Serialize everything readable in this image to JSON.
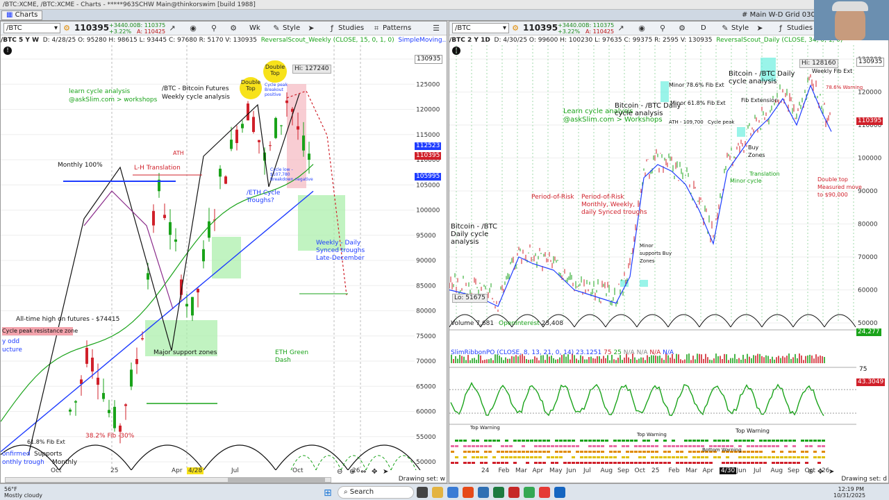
{
  "window": {
    "title": "/BTC:XCME, /BTC:XCME - Charts - *****963SCHW Main@thinkorswim [build 1988]",
    "tab_label": "Charts",
    "grid_label": "Main W-D Grid 030120"
  },
  "left": {
    "symbol": "/BTC",
    "price": "110395",
    "change": "+3440.00",
    "change_pct": "+3.22%",
    "bid": "B: 110375",
    "ask": "A: 110425",
    "timeframe": "/BTC 5 Y W",
    "info": "D: 4/28/25  O: 95280  H: 98615  L: 93445  C: 97680  R: 5170  V: 130935",
    "study_info": "ReversalScout_Weekly (CLOSE, 15, 0, 1, 0)",
    "study2": "SimpleMoving...",
    "buttons": {
      "wk": "Wk",
      "style": "Style",
      "studies": "Studies",
      "patterns": "Patterns"
    },
    "price_labels": {
      "top": "130935",
      "p1": "112523",
      "p2": "110395",
      "p3": "105995"
    },
    "y_ticks": [
      "130000",
      "125000",
      "120000",
      "115000",
      "110000",
      "105000",
      "100000",
      "95000",
      "90000",
      "85000",
      "80000",
      "75000",
      "70000",
      "65000",
      "60000",
      "55000",
      "50000"
    ],
    "x_ticks": [
      "Oct",
      "25",
      "Apr",
      "4/28",
      "Jul",
      "Oct",
      "26"
    ],
    "annotations": {
      "learn": "learn cycle analysis",
      "askslim": "@askSlim.com > workshops",
      "title1": "/BTC - Bitcoin Futures",
      "title2": "Weekly cycle analysis",
      "double_top": "Double Top",
      "double_top2": "Double Top",
      "hi": "Hi: 127240",
      "ath": "ATH",
      "monthly100": "Monthly 100%",
      "lh": "L-H Translation",
      "eth_cycle": "/ETH Cycle Troughs?",
      "weekly_daily": "Weekly - Daily Synced troughs Late-December",
      "alltime": "All-time high on futures - $74415",
      "cycle_peak": "Cycle peak resistance zone",
      "major_support": "Major support zones",
      "eth_green": "ETH Green Dash",
      "fib382": "38.2% Fib -30%",
      "fib618": "61.8% Fib Ext",
      "supports": "Supports",
      "monthly": "Monthly",
      "confirmed": "onfirmed",
      "double": "y odd",
      "ucture": "ucture",
      "onthly": "onthly trough",
      "cycle_peak_small": "Cycle peak Breakout positive",
      "cycle_low_small": "Cycle low - $107,780 Breakdown negative"
    },
    "drawing_set": "Drawing set: w"
  },
  "right": {
    "symbol": "/BTC",
    "price": "110395",
    "change": "+3440.00",
    "change_pct": "+3.22%",
    "bid": "B: 110375",
    "ask": "A: 110425",
    "timeframe": "/BTC 2 Y 1D",
    "info": "D: 4/30/25  O: 99600  H: 100230  L: 97635  C: 99375  R: 2595  V: 130935",
    "study_info": "ReversalScout_Daily (CLOSE, 34, 0, 1, 0)",
    "buttons": {
      "d": "D",
      "style": "Style",
      "studies": "Studies"
    },
    "price_labels": {
      "top": "130935",
      "p1": "110395"
    },
    "y_ticks": [
      "130000",
      "120000",
      "110000",
      "100000",
      "90000",
      "80000",
      "70000",
      "60000",
      "50000"
    ],
    "x_ticks": [
      "24",
      "Feb",
      "Mar",
      "Apr",
      "May",
      "Jun",
      "Jul",
      "Aug",
      "Sep",
      "Oct",
      "25",
      "Feb",
      "Mar",
      "Apr",
      "4/30",
      "Jun",
      "Jul",
      "Aug",
      "Sep",
      "Oct",
      "26"
    ],
    "volume": {
      "label": "Volume",
      "value": "7,681",
      "oi_label": "OpenInterest",
      "oi_value": "23,408",
      "right_value": "24,277"
    },
    "slim": {
      "label": "SlimRibbonPO (CLOSE, 8, 13, 21, 0, 14)",
      "val": "23.1251",
      "v1": "75",
      "v2": "25",
      "v3": "N/A",
      "v4": "N/A",
      "v5": "N/A",
      "v6": "N/A",
      "right": "43.3049",
      "ax75": "75"
    },
    "lo": "Lo: 51675",
    "hi": "Hi: 128160",
    "annotations": {
      "learn": "Learn cycle analysis",
      "askslim": "@askSlim.com > Workshops",
      "btc_daily": "Bitcoin - /BTC Daily cycle analysis",
      "btc_daily2": "Bitcoin - /BTC Daily cycle analysis",
      "btc_daily3": "Bitcoin - /BTC Daily cycle analysis",
      "period_risk": "Period-of-Risk Monthly, Weekly, daily Synced troughs",
      "period_risk2": "Period-of-Risk",
      "minor_fib786": "Minor 78.6% Fib Ext",
      "minor_fib618": "Minor 61.8% Fib Ext",
      "fib_ext": "Fib Extension",
      "weekly_fib": "Weekly Fib Ext",
      "warn786": "78.6% Warning",
      "double_top": "Double top Measured move to $90,000",
      "buy_zones": "Buy Zones",
      "minor_cycle": "Minor cycle",
      "minor_support": "Minor supports Buy Zones",
      "translation": "Translation",
      "top_warning": "Top Warning",
      "top_warning2": "Top Warning",
      "top_warning3": "Top Warning",
      "bottom_warning": "Bottom Warning",
      "cycle_peak": "Cycle peak",
      "ath": "ATH - 109,700"
    },
    "drawing_set": "Drawing set: d"
  },
  "taskbar": {
    "weather_temp": "56°F",
    "weather_desc": "Mostly cloudy",
    "search": "Search",
    "time": "12:19 PM",
    "date": "10/31/2025"
  },
  "colors": {
    "up": "#1aa31a",
    "down": "#d0202a",
    "accent": "#1e3cff"
  }
}
